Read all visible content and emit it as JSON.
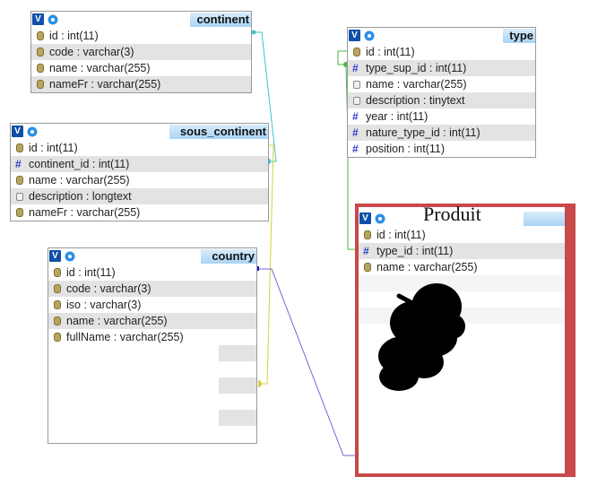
{
  "tables": {
    "continent": {
      "name": "continent",
      "rows": [
        {
          "label": "id : int(11)",
          "icon": "key-icon"
        },
        {
          "label": "code : varchar(3)",
          "icon": "key-icon"
        },
        {
          "label": "name : varchar(255)",
          "icon": "key-icon"
        },
        {
          "label": "nameFr : varchar(255)",
          "icon": "key-icon"
        }
      ]
    },
    "type": {
      "name": "type",
      "rows": [
        {
          "label": "id : int(11)",
          "icon": "key-icon"
        },
        {
          "label": "type_sup_id : int(11)",
          "icon": "hash-icon"
        },
        {
          "label": "name : varchar(255)",
          "icon": "text-icon"
        },
        {
          "label": "description : tinytext",
          "icon": "text-icon"
        },
        {
          "label": "year : int(11)",
          "icon": "hash-icon"
        },
        {
          "label": "nature_type_id : int(11)",
          "icon": "hash-icon"
        },
        {
          "label": "position : int(11)",
          "icon": "hash-icon"
        }
      ]
    },
    "sous_continent": {
      "name": "sous_continent",
      "rows": [
        {
          "label": "id : int(11)",
          "icon": "key-icon"
        },
        {
          "label": "continent_id : int(11)",
          "icon": "hash-icon"
        },
        {
          "label": "name : varchar(255)",
          "icon": "key-icon"
        },
        {
          "label": "description : longtext",
          "icon": "text-icon"
        },
        {
          "label": "nameFr : varchar(255)",
          "icon": "key-icon"
        }
      ]
    },
    "country": {
      "name": "country",
      "rows": [
        {
          "label": "id : int(11)",
          "icon": "key-icon"
        },
        {
          "label": "code : varchar(3)",
          "icon": "key-icon"
        },
        {
          "label": "iso : varchar(3)",
          "icon": "key-icon"
        },
        {
          "label": "name : varchar(255)",
          "icon": "key-icon"
        },
        {
          "label": "fullName : varchar(255)",
          "icon": "key-icon"
        }
      ]
    },
    "produit": {
      "name": "Produit",
      "rows": [
        {
          "label": "id : int(11)",
          "icon": "key-icon"
        },
        {
          "label": "type_id : int(11)",
          "icon": "hash-icon"
        },
        {
          "label": "name : varchar(255)",
          "icon": "key-icon"
        }
      ]
    }
  },
  "colors": {
    "produit_frame": "#c7494a",
    "link_continent": "#3fc4c4",
    "link_type": "#44bb44",
    "link_country_yellow": "#d8d040",
    "link_country_blue": "#6a6ad8"
  }
}
